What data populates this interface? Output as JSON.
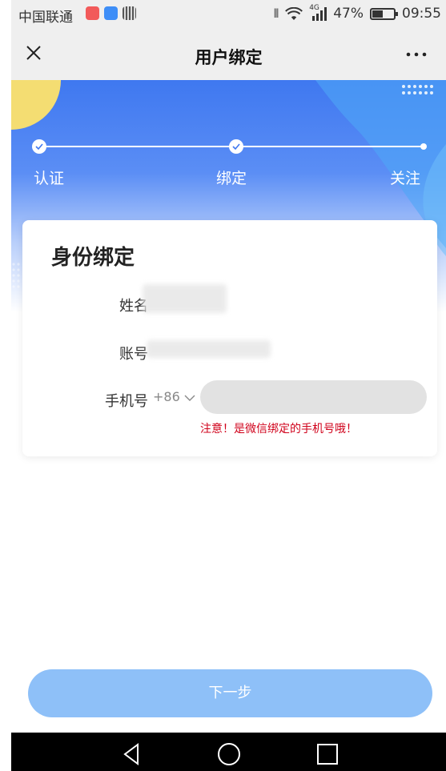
{
  "status_bar": {
    "carrier": "中国联通",
    "signal_type": "4G",
    "battery_percent": "47%",
    "time": "09:55",
    "app_icons": [
      "red-app-icon",
      "blue-app-icon",
      "qr-app-icon"
    ]
  },
  "nav": {
    "title": "用户绑定",
    "close_icon": "close-icon",
    "more_icon": "more-icon"
  },
  "steps": [
    {
      "label": "认证",
      "done": true
    },
    {
      "label": "绑定",
      "done": true
    },
    {
      "label": "关注",
      "done": false
    }
  ],
  "card": {
    "title": "身份绑定",
    "fields": {
      "name_label": "姓名",
      "account_label": "账号",
      "phone_label": "手机号",
      "country_code": "+86",
      "phone_value": ""
    },
    "warning": "注意！是微信绑定的手机号哦！"
  },
  "next_button": "下一步",
  "colors": {
    "primary": "#3f78f0",
    "button": "#8ec0f8",
    "warning": "#d0021b"
  }
}
